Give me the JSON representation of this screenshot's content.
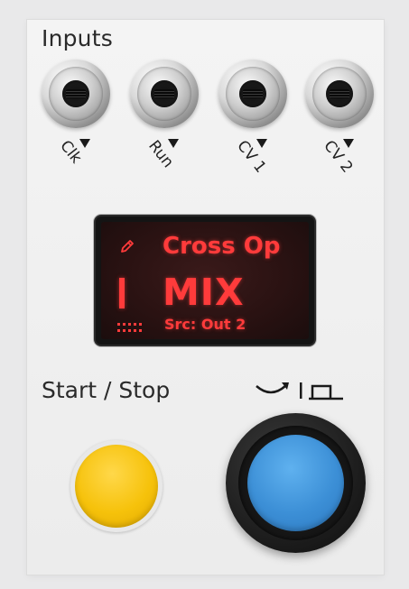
{
  "module": {
    "section_inputs": "Inputs",
    "section_start_stop": "Start / Stop"
  },
  "jacks": [
    {
      "label": "Clk"
    },
    {
      "label": "Run"
    },
    {
      "label": "CV 1"
    },
    {
      "label": "CV 2"
    }
  ],
  "display": {
    "mode_icon": "pencil-icon",
    "title": "Cross Op",
    "value": "MIX",
    "source": "Src: Out 2",
    "color": "#ff3b3b"
  },
  "controls": {
    "start_stop_button_color": "#f6c20b",
    "main_button_color": "#3c8fd6",
    "mode_icons": [
      "arrow-curve-icon",
      "divider",
      "square-gate-icon"
    ]
  }
}
